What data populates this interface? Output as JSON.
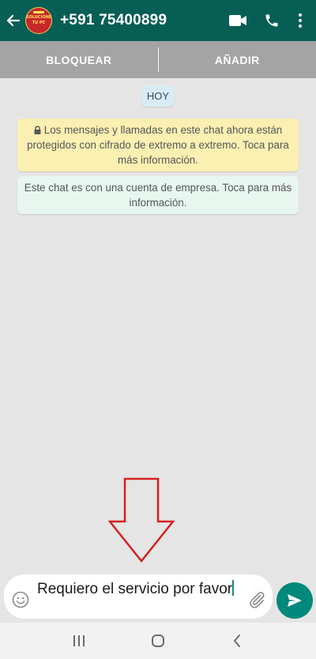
{
  "header": {
    "title": "+591 75400899",
    "avatar_text_line1": "SOLUCIONES",
    "avatar_text_line2": "TU PC",
    "icons": [
      "back-arrow-icon",
      "video-call-icon",
      "voice-call-icon",
      "more-options-icon"
    ],
    "background_color": "#075e54"
  },
  "actions": {
    "block_label": "BLOQUEAR",
    "add_label": "AÑADIR"
  },
  "chat": {
    "date_label": "HOY",
    "encryption_notice": "Los mensajes y llamadas en este chat ahora están protegidos con cifrado de extremo a extremo. Toca para más información.",
    "business_notice": "Este chat es con una cuenta de empresa. Toca para más información."
  },
  "composer": {
    "text": "Requiero el servicio por favor",
    "icons": [
      "emoji-icon",
      "attach-icon",
      "send-icon"
    ],
    "send_color": "#00897b"
  },
  "system_nav": {
    "icons": [
      "recent-apps-icon",
      "home-icon",
      "back-icon"
    ]
  }
}
